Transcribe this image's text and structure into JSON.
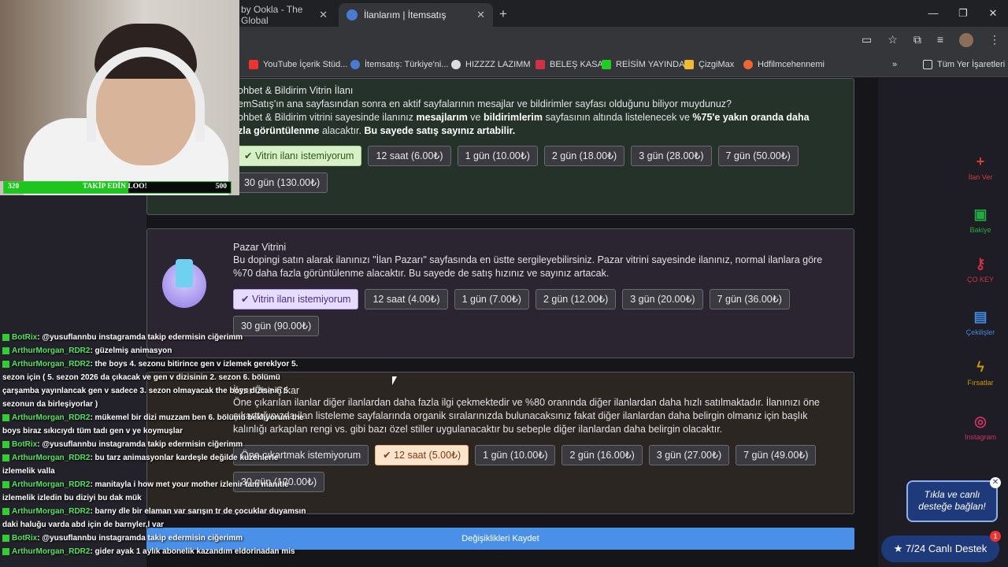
{
  "tabs": [
    {
      "title": "by Ookla - The Global"
    },
    {
      "title": "İlanlarım | İtemsatış"
    }
  ],
  "bookmarks": [
    "YouTube İçerik Stüd...",
    "İtemsatış: Türkiye'ni...",
    "HIZZZZ LAZIMM",
    "BELEŞ KASA",
    "REİSİM YAYINDA",
    "ÇizgiMax",
    "Hdfilmcehennemi",
    "Tüm Yer İşaretleri"
  ],
  "cards": [
    {
      "title": "ohbet & Bildirim Vitrin İlanı",
      "desc": [
        "emSatış'ın ana sayfasından sonra en aktif sayfalarının mesajlar ve bildirimler sayfası olduğunu biliyor muydunuz?",
        "ohbet & Bildirim vitrini sayesinde ilanınız ",
        "mesajlarım",
        " ve ",
        "bildirimlerim",
        " sayfasının altında listelenecek ve ",
        "%75'e yakın oranda daha",
        "zla görüntülenme",
        " alacaktır. ",
        "Bu sayede satış sayınız artabilir."
      ],
      "options": [
        "Vitrin ilanı istemiyorum",
        "12 saat (6.00₺)",
        "1 gün (10.00₺)",
        "2 gün (18.00₺)",
        "3 gün (28.00₺)",
        "7 gün (50.00₺)",
        "30 gün (130.00₺)"
      ]
    },
    {
      "title": "Pazar Vitrini",
      "desc": "Bu dopingi satın alarak ilanınızı \"İlan Pazarı\" sayfasında en üstte sergileyebilirsiniz. Pazar vitrini sayesinde ilanınız, normal ilanlara göre %70 daha fazla görüntülenme alacaktır. Bu sayede de satış hızınız ve sayınız artacak.",
      "options": [
        "Vitrin ilanı istemiyorum",
        "12 saat (4.00₺)",
        "1 gün (7.00₺)",
        "2 gün (12.00₺)",
        "3 gün (20.00₺)",
        "7 gün (36.00₺)",
        "30 gün (90.00₺)"
      ]
    },
    {
      "title": "İlanı Öne Çıkar",
      "desc": "Öne çıkarılan ilanlar diğer ilanlardan daha fazla ilgi çekmektedir ve %80 oranında diğer ilanlardan daha hızlı satılmaktadır. İlanınızı öne çıkarttığınızda ilan listeleme sayfalarında organik sıralarınızda bulunacaksınız fakat diğer ilanlardan daha belirgin olmanız için başlık kalınlığı arkaplan rengi vs. gibi bazı özel stiller uygulanacaktır bu sebeple diğer ilanlardan daha belirgin olacaktır.",
      "options": [
        "Öne çıkartmak istemiyorum",
        "12 saat (5.00₺)",
        "1 gün (10.00₺)",
        "2 gün (16.00₺)",
        "3 gün (27.00₺)",
        "7 gün (49.00₺)",
        "30 gün (120.00₺)"
      ]
    }
  ],
  "save_label": "Değişiklikleri Kaydet",
  "goal": {
    "left": "320",
    "text": "TAKİP EDİN LOO!",
    "right": "500",
    "fill": 0.55
  },
  "chat": [
    {
      "user": "BotRix",
      "msg": ": @yusuflannbu instagramda takip edermisin ciğerimm"
    },
    {
      "user": "ArthurMorgan_RDR2",
      "msg": ": güzelmiş animasyon"
    },
    {
      "user": "ArthurMorgan_RDR2",
      "msg": ": the boys 4. sezonu bitirince gen v izlemek gereklyor 5. sezon için ( 5. sezon 2026 da çıkacak ve gen v dizisinin 2. sezon 6. bölümü çarşamba yayınlancak gen v sadece 3. sezon olmayacak the boys dizisinin 5. sezonun da birleşiyorlar )"
    },
    {
      "user": "ArthurMorgan_RDR2",
      "msg": ": mükemel bir dizi muzzam ben 6. bölümü bekliyorum the boys biraz sıkıcıydı tüm tadı gen v ye koymuşlar"
    },
    {
      "user": "BotRix",
      "msg": ": @yusuflannbu instagramda takip edermisin ciğerimm"
    },
    {
      "user": "ArthurMorgan_RDR2",
      "msg": ": bu tarz animasyonlar kardeşle değilde kuzenlerle izlemelik valla"
    },
    {
      "user": "ArthurMorgan_RDR2",
      "msg": ": manitayla i how met your mother izlenir tam manitle izlemelik izledin bu diziyi bu dak mük"
    },
    {
      "user": "ArthurMorgan_RDR2",
      "msg": ": barny dle bir elaman var sarışın tr de çocuklar duyamsın daki haluğu varda abd için de barnyler,l var"
    },
    {
      "user": "BotRix",
      "msg": ": @yusuflannbu instagramda takip edermisin ciğerimm"
    },
    {
      "user": "ArthurMorgan_RDR2",
      "msg": ": gider ayak 1 aylık abonelik kazandım eldorinadan mis"
    }
  ],
  "support": {
    "bubble": "Tıkla ve canlı desteğe bağlan!",
    "button": "★ 7/24 Canlı Destek",
    "badge": "1"
  },
  "right_nav": [
    "İlan Ver",
    "Bakiye",
    "ÇO KEY",
    "Çekilişler",
    "Fırsatlar",
    "Instagram"
  ]
}
